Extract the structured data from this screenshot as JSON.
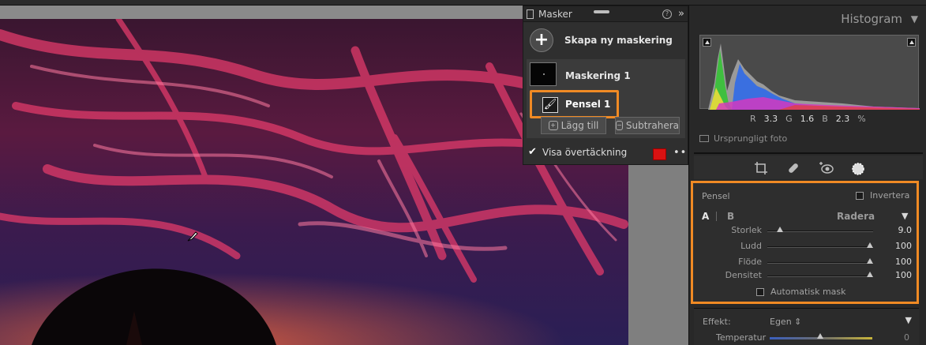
{
  "mask_panel": {
    "title": "Masker",
    "help": "?",
    "collapse": "»",
    "create_label": "Skapa ny maskering",
    "mask_name": "Maskering 1",
    "brush_label": "Pensel 1",
    "add_label": "Lägg till",
    "subtract_label": "Subtrahera",
    "overlay_label": "Visa övertäckning",
    "overlay_color": "#d81212",
    "more": "•••"
  },
  "histogram": {
    "title": "Histogram",
    "r_label": "R",
    "r_value": "3.3",
    "g_label": "G",
    "g_value": "1.6",
    "b_label": "B",
    "b_value": "2.3",
    "unit": "%",
    "original_label": "Ursprungligt foto"
  },
  "tools": [
    "crop-icon",
    "heal-icon",
    "redeye-icon",
    "mask-icon"
  ],
  "brush_panel": {
    "title": "Pensel",
    "invert_label": "Invertera",
    "tab_a": "A",
    "tab_b": "B",
    "erase_label": "Radera",
    "sliders": [
      {
        "label": "Storlek",
        "value": "9.0",
        "pos": 0.12
      },
      {
        "label": "Ludd",
        "value": "100",
        "pos": 0.97
      },
      {
        "label": "Flöde",
        "value": "100",
        "pos": 0.97
      },
      {
        "label": "Densitet",
        "value": "100",
        "pos": 0.97
      }
    ],
    "auto_mask_label": "Automatisk mask"
  },
  "effect_panel": {
    "label": "Effekt:",
    "value": "Egen ⇕",
    "temp_label": "Temperatur",
    "temp_value": "0"
  }
}
